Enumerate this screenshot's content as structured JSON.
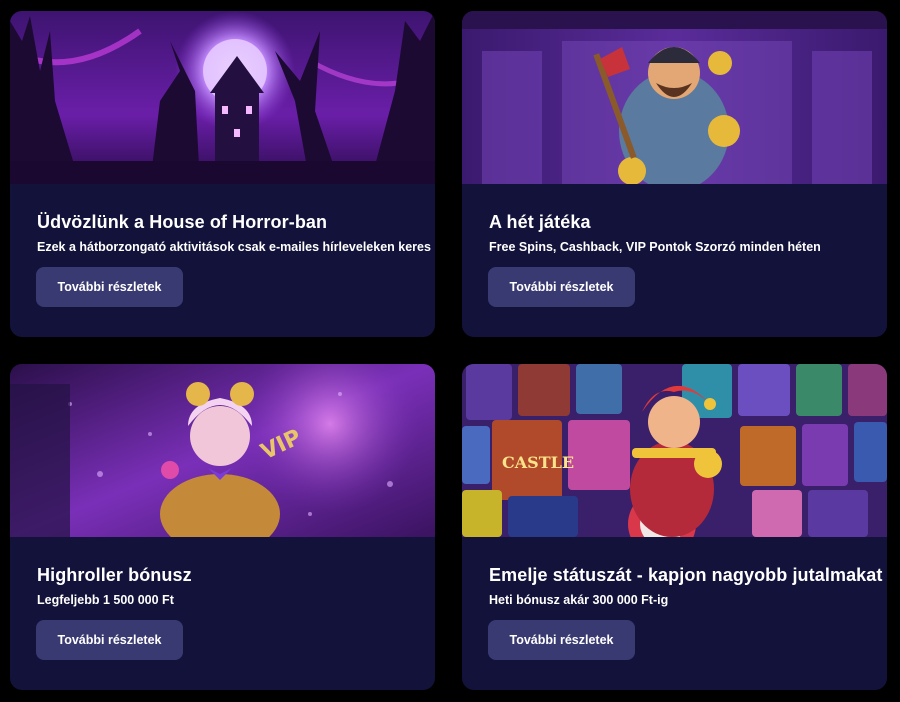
{
  "colors": {
    "page_background": "#000000",
    "card_background": "#13123a",
    "button_background": "#3a3a73",
    "text": "#ffffff"
  },
  "cards": [
    {
      "title": "Üdvözlünk a House of Horror-ban",
      "subtitle": "Ezek a hátborzongató aktivitások csak e-mailes hírleveleken keres",
      "button_label": "További részletek",
      "banner": "haunted-house-illustration"
    },
    {
      "title": "A hét játéka",
      "subtitle": "Free Spins, Cashback, VIP Pontok Szorzó minden héten",
      "button_label": "További részletek",
      "banner": "pirate-character-illustration"
    },
    {
      "title": "Highroller bónusz",
      "subtitle": "Legfeljebb 1 500 000 Ft",
      "button_label": "További részletek",
      "banner": "harlequin-vip-illustration"
    },
    {
      "title": "Emelje státuszát - kapjon nagyobb jutalmakat",
      "subtitle": "Heti bónusz akár 300 000 Ft-ig",
      "button_label": "További részletek",
      "banner": "jester-slot-games-illustration"
    }
  ]
}
